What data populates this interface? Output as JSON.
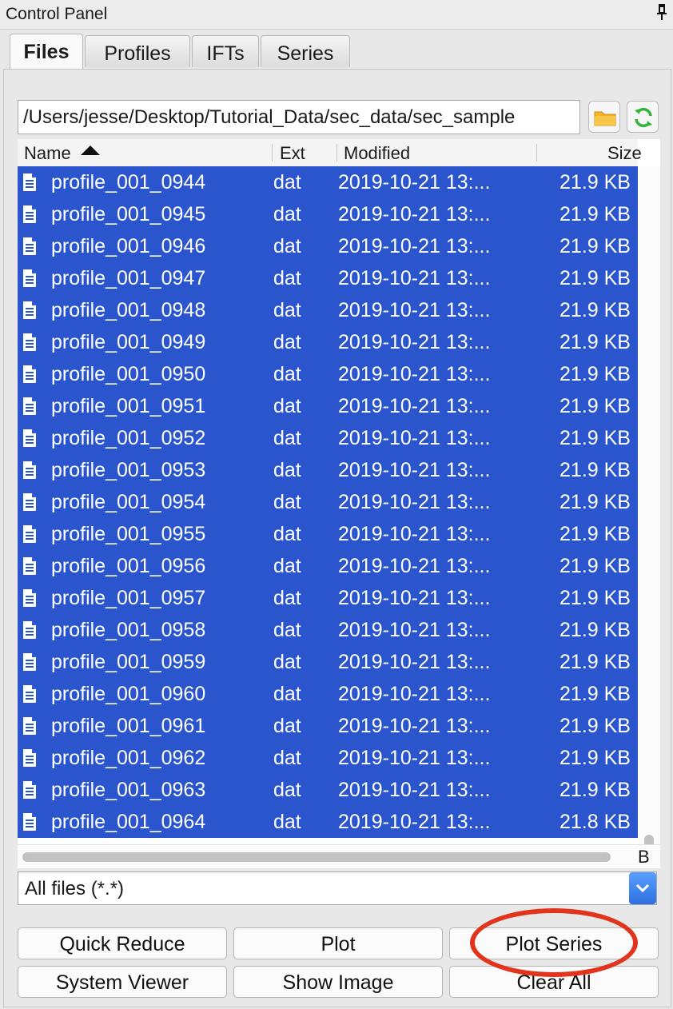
{
  "window": {
    "title": "Control Panel",
    "pin_icon": "pin-icon"
  },
  "tabs": [
    {
      "label": "Files"
    },
    {
      "label": "Profiles"
    },
    {
      "label": "IFTs"
    },
    {
      "label": "Series"
    }
  ],
  "path": {
    "value": "/Users/jesse/Desktop/Tutorial_Data/sec_data/sec_sample"
  },
  "icons": {
    "folder": "folder-icon",
    "refresh": "refresh-icon",
    "file": "file-icon"
  },
  "columns": {
    "name": "Name",
    "ext": "Ext",
    "modified": "Modified",
    "size": "Size"
  },
  "files": [
    {
      "name": "profile_001_0944",
      "ext": "dat",
      "modified": "2019-10-21 13:...",
      "size": "21.9 KB"
    },
    {
      "name": "profile_001_0945",
      "ext": "dat",
      "modified": "2019-10-21 13:...",
      "size": "21.9 KB"
    },
    {
      "name": "profile_001_0946",
      "ext": "dat",
      "modified": "2019-10-21 13:...",
      "size": "21.9 KB"
    },
    {
      "name": "profile_001_0947",
      "ext": "dat",
      "modified": "2019-10-21 13:...",
      "size": "21.9 KB"
    },
    {
      "name": "profile_001_0948",
      "ext": "dat",
      "modified": "2019-10-21 13:...",
      "size": "21.9 KB"
    },
    {
      "name": "profile_001_0949",
      "ext": "dat",
      "modified": "2019-10-21 13:...",
      "size": "21.9 KB"
    },
    {
      "name": "profile_001_0950",
      "ext": "dat",
      "modified": "2019-10-21 13:...",
      "size": "21.9 KB"
    },
    {
      "name": "profile_001_0951",
      "ext": "dat",
      "modified": "2019-10-21 13:...",
      "size": "21.9 KB"
    },
    {
      "name": "profile_001_0952",
      "ext": "dat",
      "modified": "2019-10-21 13:...",
      "size": "21.9 KB"
    },
    {
      "name": "profile_001_0953",
      "ext": "dat",
      "modified": "2019-10-21 13:...",
      "size": "21.9 KB"
    },
    {
      "name": "profile_001_0954",
      "ext": "dat",
      "modified": "2019-10-21 13:...",
      "size": "21.9 KB"
    },
    {
      "name": "profile_001_0955",
      "ext": "dat",
      "modified": "2019-10-21 13:...",
      "size": "21.9 KB"
    },
    {
      "name": "profile_001_0956",
      "ext": "dat",
      "modified": "2019-10-21 13:...",
      "size": "21.9 KB"
    },
    {
      "name": "profile_001_0957",
      "ext": "dat",
      "modified": "2019-10-21 13:...",
      "size": "21.9 KB"
    },
    {
      "name": "profile_001_0958",
      "ext": "dat",
      "modified": "2019-10-21 13:...",
      "size": "21.9 KB"
    },
    {
      "name": "profile_001_0959",
      "ext": "dat",
      "modified": "2019-10-21 13:...",
      "size": "21.9 KB"
    },
    {
      "name": "profile_001_0960",
      "ext": "dat",
      "modified": "2019-10-21 13:...",
      "size": "21.9 KB"
    },
    {
      "name": "profile_001_0961",
      "ext": "dat",
      "modified": "2019-10-21 13:...",
      "size": "21.9 KB"
    },
    {
      "name": "profile_001_0962",
      "ext": "dat",
      "modified": "2019-10-21 13:...",
      "size": "21.9 KB"
    },
    {
      "name": "profile_001_0963",
      "ext": "dat",
      "modified": "2019-10-21 13:...",
      "size": "21.9 KB"
    },
    {
      "name": "profile_001_0964",
      "ext": "dat",
      "modified": "2019-10-21 13:...",
      "size": "21.8 KB"
    }
  ],
  "hscroll_clip": "B",
  "filter": {
    "selected": "All files (*.*)"
  },
  "buttons": {
    "quick_reduce": "Quick Reduce",
    "plot": "Plot",
    "plot_series": "Plot Series",
    "system_viewer": "System Viewer",
    "show_image": "Show Image",
    "clear_all": "Clear All"
  },
  "colors": {
    "selection": "#2a55cc",
    "callout": "#e2341d",
    "dropdown": "#2f6fe0",
    "folder": "#f2b52a",
    "refresh": "#34b53a"
  }
}
